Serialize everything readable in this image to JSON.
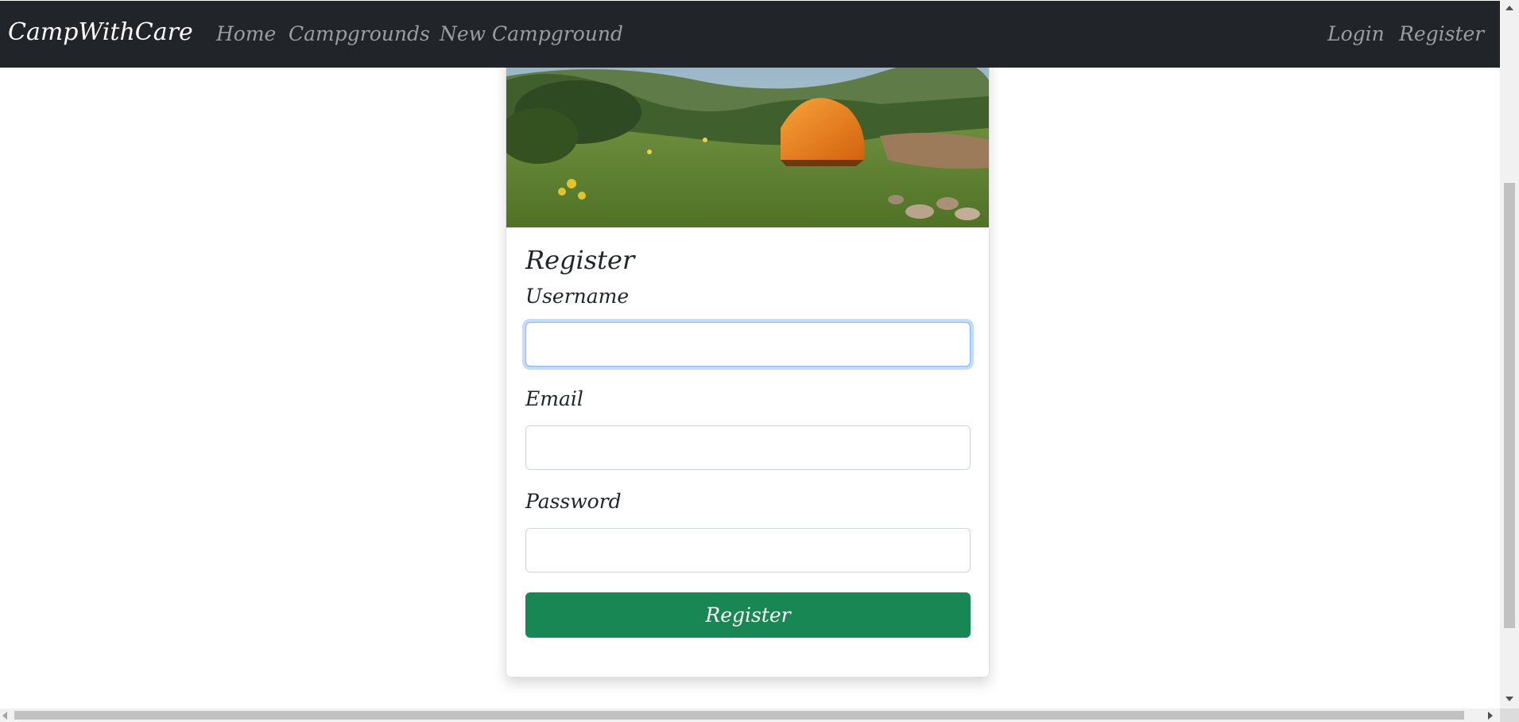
{
  "navbar": {
    "brand": "CampWithCare",
    "links": {
      "home": "Home",
      "campgrounds": "Campgrounds",
      "new_campground": "New Campground",
      "login": "Login",
      "register": "Register"
    }
  },
  "form": {
    "title": "Register",
    "username_label": "Username",
    "username_value": "",
    "email_label": "Email",
    "email_value": "",
    "password_label": "Password",
    "password_value": "",
    "submit_label": "Register"
  },
  "colors": {
    "navbar_bg": "#212529",
    "submit_bg": "#198754",
    "focus_ring": "#86b7fe"
  },
  "icons": {
    "scroll_up": "arrow-up-icon",
    "scroll_down": "arrow-down-icon",
    "scroll_left": "arrow-left-icon",
    "scroll_right": "arrow-right-icon"
  }
}
